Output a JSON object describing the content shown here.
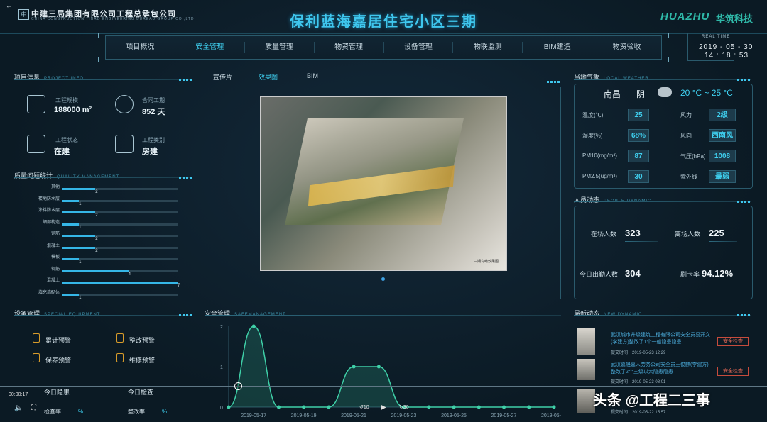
{
  "header": {
    "company": "中建三局集团有限公司工程总承包公司",
    "company_en": "CHINA CONSTRUCTION THIRD ENGINEERING BUREAU GROUP CO.,LTD",
    "logo_text": "中",
    "title": "保利蓝海嘉居住宅小区三期",
    "brand": "HUAZHU",
    "brand_cn": "华筑科技",
    "realtime_label": "REAL TIME",
    "date": "2019 - 05 - 30",
    "time": "14 : 18 : 53",
    "back": "←"
  },
  "nav": {
    "items": [
      "项目概况",
      "安全管理",
      "质量管理",
      "物资管理",
      "设备管理",
      "物联监测",
      "BIM建造",
      "物资验收"
    ]
  },
  "project_info": {
    "title": "项目信息",
    "title_en": "PROJECT INFO",
    "items": [
      {
        "label": "工程规模",
        "value": "188000 m²",
        "icon": "ruler-icon"
      },
      {
        "label": "合同工期",
        "value": "852 天",
        "icon": "calendar-icon"
      },
      {
        "label": "工程状态",
        "value": "在建",
        "icon": "status-icon"
      },
      {
        "label": "工程类别",
        "value": "房建",
        "icon": "category-icon"
      }
    ]
  },
  "quality": {
    "title": "质量问题统计",
    "title_en": "QUALITY MANAGEMENT",
    "rows": [
      {
        "label": "其他",
        "value": 2
      },
      {
        "label": "楼地防水层",
        "value": 1
      },
      {
        "label": "涂料防水层",
        "value": 2
      },
      {
        "label": "细部构造",
        "value": 1
      },
      {
        "label": "钢筋",
        "value": 2
      },
      {
        "label": "混凝土",
        "value": 2
      },
      {
        "label": "模板",
        "value": 1
      },
      {
        "label": "钢筋",
        "value": 4
      },
      {
        "label": "混凝土",
        "value": 7
      },
      {
        "label": "填充墙砌体",
        "value": 1
      }
    ],
    "max": 7
  },
  "center": {
    "tabs": [
      "宣传片",
      "效果图",
      "BIM"
    ],
    "active_tab": 1,
    "image_caption": "三期鸟瞰效果图"
  },
  "weather": {
    "title": "当地气象",
    "title_en": "LOCAL WEATHER",
    "city": "南昌",
    "condition": "阴",
    "temp": "20 °C ~ 25 °C",
    "rows": [
      {
        "label": "温度(℃)",
        "value": "25",
        "label2": "风力",
        "value2": "2级"
      },
      {
        "label": "湿度(%)",
        "value": "68%",
        "label2": "风向",
        "value2": "西南风"
      },
      {
        "label": "PM10(mg/m³)",
        "value": "87",
        "label2": "气压(hPa)",
        "value2": "1008"
      },
      {
        "label": "PM2.5(ug/m³)",
        "value": "30",
        "label2": "紫外线",
        "value2": "最弱"
      }
    ]
  },
  "people": {
    "title": "人员动态",
    "title_en": "PEOPLE DYNAMIC",
    "onsite_label": "在场人数",
    "onsite": "323",
    "leave_label": "离场人数",
    "leave": "225",
    "today_label": "今日出勤人数",
    "today": "304",
    "rate_label": "刷卡率",
    "rate": "94.12%"
  },
  "news": {
    "title": "最新动态",
    "title_en": "NEW DYNAMIC",
    "items": [
      {
        "text": "武汉城市升级建筑工程有限公司安全员易开文(李建方)整改了1个一般隐患隐患",
        "date": "提交时间：2019-05-23 12:29",
        "tag": "安全检查"
      },
      {
        "text": "武汉嘉晟嘉人劳务公司安全员王俊麒(李建方)整改了2个三级以大隐患隐患",
        "date": "提交时间：2019-05-23 08:01",
        "tag": "安全检查"
      },
      {
        "text": "",
        "date": "提交时间：2019-05-22 15:57",
        "tag": ""
      }
    ]
  },
  "equipment": {
    "title": "设备管理",
    "title_en": "SPECIAL EQUIPMENT",
    "items": [
      "累计预警",
      "整改预警",
      "保养预警",
      "维修预警"
    ]
  },
  "safety": {
    "title": "安全管理",
    "title_en": "SAFEMANAGEMENT",
    "today_hazard": "今日隐患",
    "today_check": "今日检查",
    "check_rate": "检查率",
    "fix_rate": "整改率",
    "pct": "%"
  },
  "chart_data": {
    "type": "area",
    "x": [
      "2019-05-17",
      "2019-05-19",
      "2019-05-21",
      "2019-05-23",
      "2019-05-25",
      "2019-05-27",
      "2019-05-29"
    ],
    "points": [
      {
        "x": "2019-05-16",
        "y": 0
      },
      {
        "x": "2019-05-17",
        "y": 2
      },
      {
        "x": "2019-05-18",
        "y": 0
      },
      {
        "x": "2019-05-19",
        "y": 0
      },
      {
        "x": "2019-05-20",
        "y": 0
      },
      {
        "x": "2019-05-21",
        "y": 1
      },
      {
        "x": "2019-05-22",
        "y": 1
      },
      {
        "x": "2019-05-23",
        "y": 0
      },
      {
        "x": "2019-05-24",
        "y": 0
      },
      {
        "x": "2019-05-25",
        "y": 0
      },
      {
        "x": "2019-05-26",
        "y": 0
      },
      {
        "x": "2019-05-27",
        "y": 0
      },
      {
        "x": "2019-05-28",
        "y": 0
      },
      {
        "x": "2019-05-29",
        "y": 0
      }
    ],
    "yticks": [
      "0",
      "1",
      "2"
    ],
    "ylim": [
      0,
      2
    ],
    "color": "#3fd0a8"
  },
  "video": {
    "time": "00:00:17",
    "rewind": "10",
    "forward": "30"
  },
  "watermark": "头条 @工程二三事"
}
